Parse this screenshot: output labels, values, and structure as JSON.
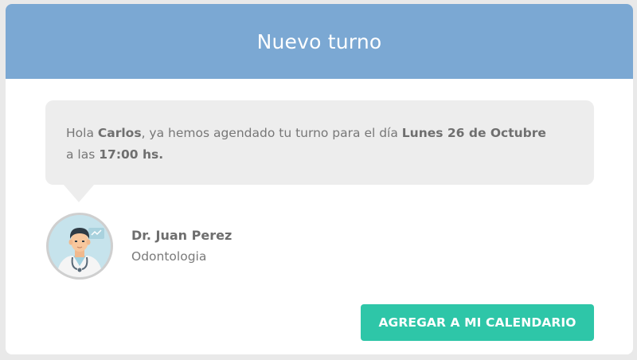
{
  "header": {
    "title": "Nuevo turno"
  },
  "message": {
    "greeting": "Hola",
    "patient_name": "Carlos",
    "text_before_date": ", ya hemos agendado tu turno para el día",
    "date": "Lunes 26 de Octubre",
    "text_before_time": "a las",
    "time": "17:00 hs.",
    "bubble_color": "#ededed"
  },
  "doctor": {
    "avatar_icon": "doctor-avatar-icon",
    "name": "Dr. Juan Perez",
    "specialty": "Odontologia"
  },
  "actions": {
    "add_to_calendar_label": "AGREGAR A MI CALENDARIO"
  },
  "colors": {
    "header": "#7ba8d3",
    "accent_button": "#2ec6a8",
    "background": "#e9e9e9"
  }
}
